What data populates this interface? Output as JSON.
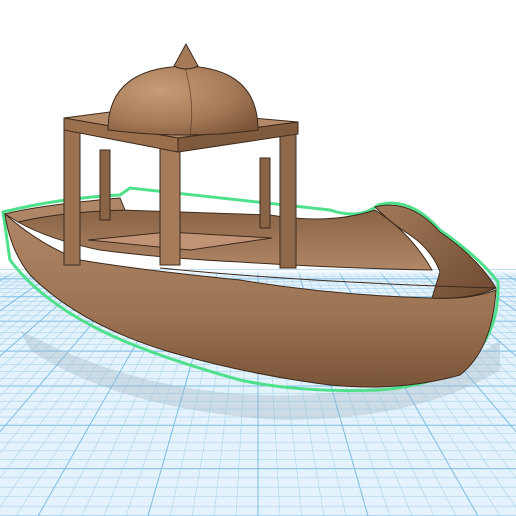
{
  "workplane": {
    "minor_line_color": "#a9d3ee",
    "major_line_color": "#7fbde6",
    "fill_color": "#e3f2fb"
  },
  "model": {
    "outline_color": "#4ee08a",
    "wood_light": "#b48a66",
    "wood_mid": "#9a6f4d",
    "wood_dark": "#6f4a30",
    "shadow_color": "#9fb4c4"
  }
}
